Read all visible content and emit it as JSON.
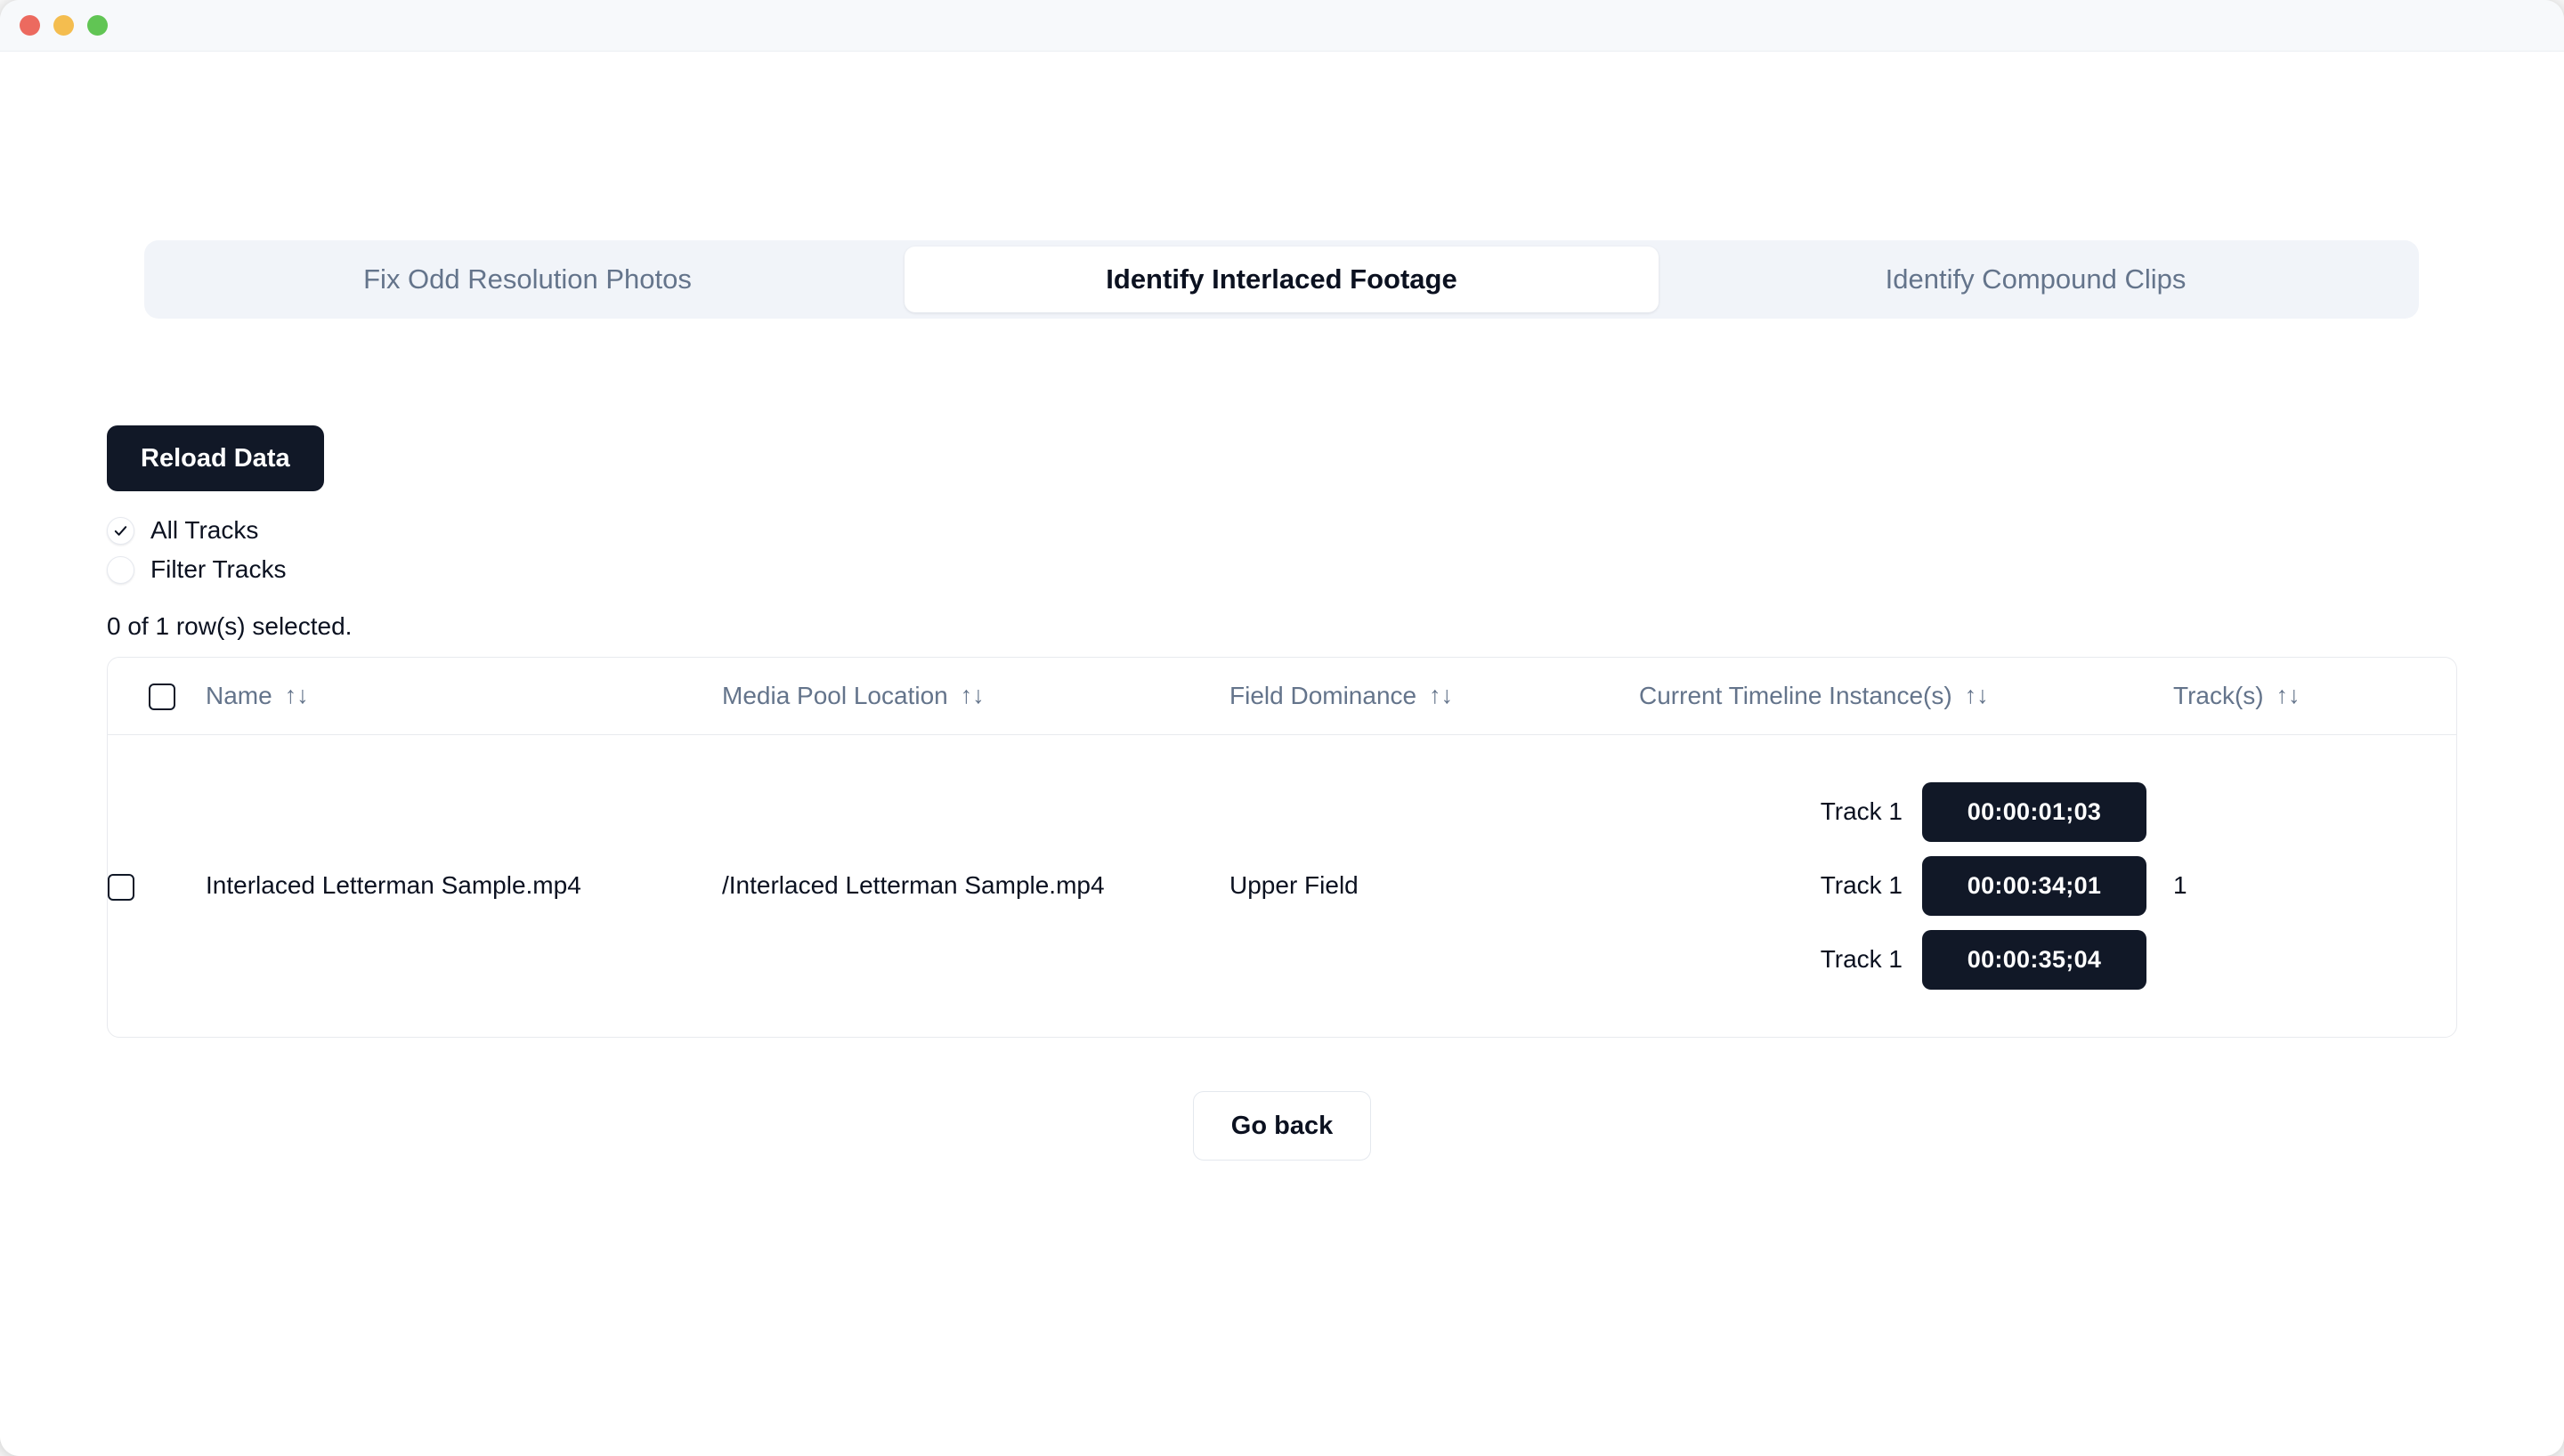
{
  "window": {
    "traffic_lights": [
      "close",
      "minimize",
      "maximize"
    ]
  },
  "tabs": [
    {
      "label": "Fix Odd Resolution Photos",
      "active": false
    },
    {
      "label": "Identify Interlaced Footage",
      "active": true
    },
    {
      "label": "Identify Compound Clips",
      "active": false
    }
  ],
  "toolbar": {
    "reload_label": "Reload Data"
  },
  "filters": {
    "options": [
      {
        "label": "All Tracks",
        "selected": true
      },
      {
        "label": "Filter Tracks",
        "selected": false
      }
    ]
  },
  "table": {
    "selection_status": "0 of 1 row(s) selected.",
    "sort_icon": "↑↓",
    "columns": [
      {
        "key": "select",
        "label": ""
      },
      {
        "key": "name",
        "label": "Name"
      },
      {
        "key": "media_pool_location",
        "label": "Media Pool Location"
      },
      {
        "key": "field_dominance",
        "label": "Field Dominance"
      },
      {
        "key": "current_timeline_instances",
        "label": "Current Timeline Instance(s)"
      },
      {
        "key": "tracks",
        "label": "Track(s)"
      }
    ],
    "rows": [
      {
        "selected": false,
        "name": "Interlaced Letterman Sample.mp4",
        "media_pool_location": "/Interlaced Letterman Sample.mp4",
        "field_dominance": "Upper Field",
        "instances": [
          {
            "track": "Track 1",
            "timecode": "00:00:01;03"
          },
          {
            "track": "Track 1",
            "timecode": "00:00:34;01"
          },
          {
            "track": "Track 1",
            "timecode": "00:00:35;04"
          }
        ],
        "tracks": "1"
      }
    ]
  },
  "footer": {
    "go_back_label": "Go back"
  },
  "colors": {
    "accent_dark": "#111827",
    "tabbar_bg": "#f1f4f9",
    "muted_text": "#64748b",
    "border": "#e8eaee"
  }
}
